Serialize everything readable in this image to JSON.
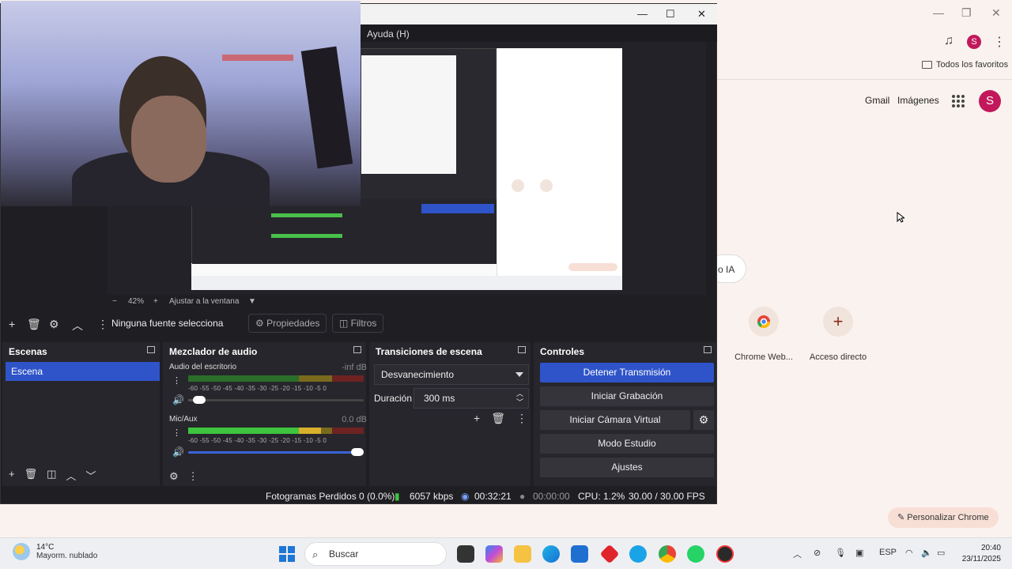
{
  "chrome": {
    "bookmarks_label": "Todos los favoritos",
    "links": {
      "gmail": "Gmail",
      "images": "Imágenes"
    },
    "profile_initial": "S",
    "ia_button": "o IA",
    "shortcuts": [
      {
        "label": "Chrome Web..."
      },
      {
        "label": "Acceso directo",
        "icon": "+"
      }
    ],
    "personalize_label": "Personalizar Chrome"
  },
  "obs": {
    "menu_help": "Ayuda (H)",
    "zoom_level": "42%",
    "zoom_fit": "Ajustar a la ventana",
    "no_source": "Ninguna fuente selecciona",
    "properties_label": "Propiedades",
    "filters_label": "Filtros",
    "scenes": {
      "title": "Escenas",
      "items": [
        "Escena"
      ]
    },
    "mixer": {
      "title": "Mezclador de audio",
      "ticks": "-60 -55 -50 -45 -40 -35 -30 -25 -20 -15 -10 -5 0",
      "channels": [
        {
          "name": "Audio del escritorio",
          "db": "-inf dB",
          "volume": 0.03
        },
        {
          "name": "Mic/Aux",
          "db": "0.0 dB",
          "volume": 1.0
        }
      ]
    },
    "transitions": {
      "title": "Transiciones de escena",
      "selected": "Desvanecimiento",
      "duration_label": "Duración",
      "duration_value": "300 ms"
    },
    "controls": {
      "title": "Controles",
      "stop_stream": "Detener Transmisión",
      "start_recording": "Iniciar Grabación",
      "virtual_cam": "Iniciar Cámara Virtual",
      "studio_mode": "Modo Estudio",
      "settings": "Ajustes"
    },
    "status": {
      "dropped_frames": "Fotogramas Perdidos 0 (0.0%)",
      "bitrate": "6057 kbps",
      "stream_time": "00:32:21",
      "record_time": "00:00:00",
      "cpu": "CPU: 1.2%",
      "fps": "30.00 / 30.00 FPS"
    }
  },
  "taskbar": {
    "weather_temp": "14°C",
    "weather_desc": "Mayorm. nublado",
    "search_placeholder": "Buscar",
    "language": "ESP",
    "time": "20:40",
    "date": "23/11/2025"
  }
}
